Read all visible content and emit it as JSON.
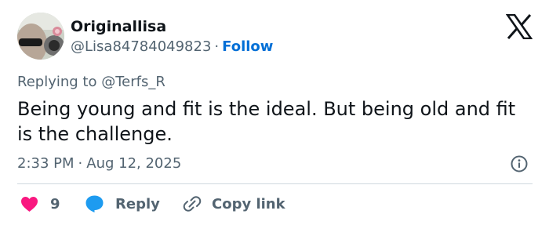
{
  "author": {
    "name": "Originallisa",
    "handle": "@Lisa84784049823",
    "separator": "·",
    "follow_label": "Follow"
  },
  "platform_icon": "x-logo-icon",
  "reply_prefix": "Replying to",
  "reply_to_handle": "@Terfs_R",
  "tweet_text": "Being young and fit is the ideal. But being old and fit is the challenge.",
  "timestamp": {
    "time": "2:33 PM",
    "separator": "·",
    "date": "Aug 12, 2025"
  },
  "actions": {
    "like_count": "9",
    "reply_label": "Reply",
    "copy_label": "Copy link"
  },
  "colors": {
    "like": "#f91880",
    "reply": "#1d9bf0",
    "follow": "#006fd6",
    "secondary_text": "#536471",
    "primary_text": "#0f1419",
    "divider": "#cfd9de"
  }
}
